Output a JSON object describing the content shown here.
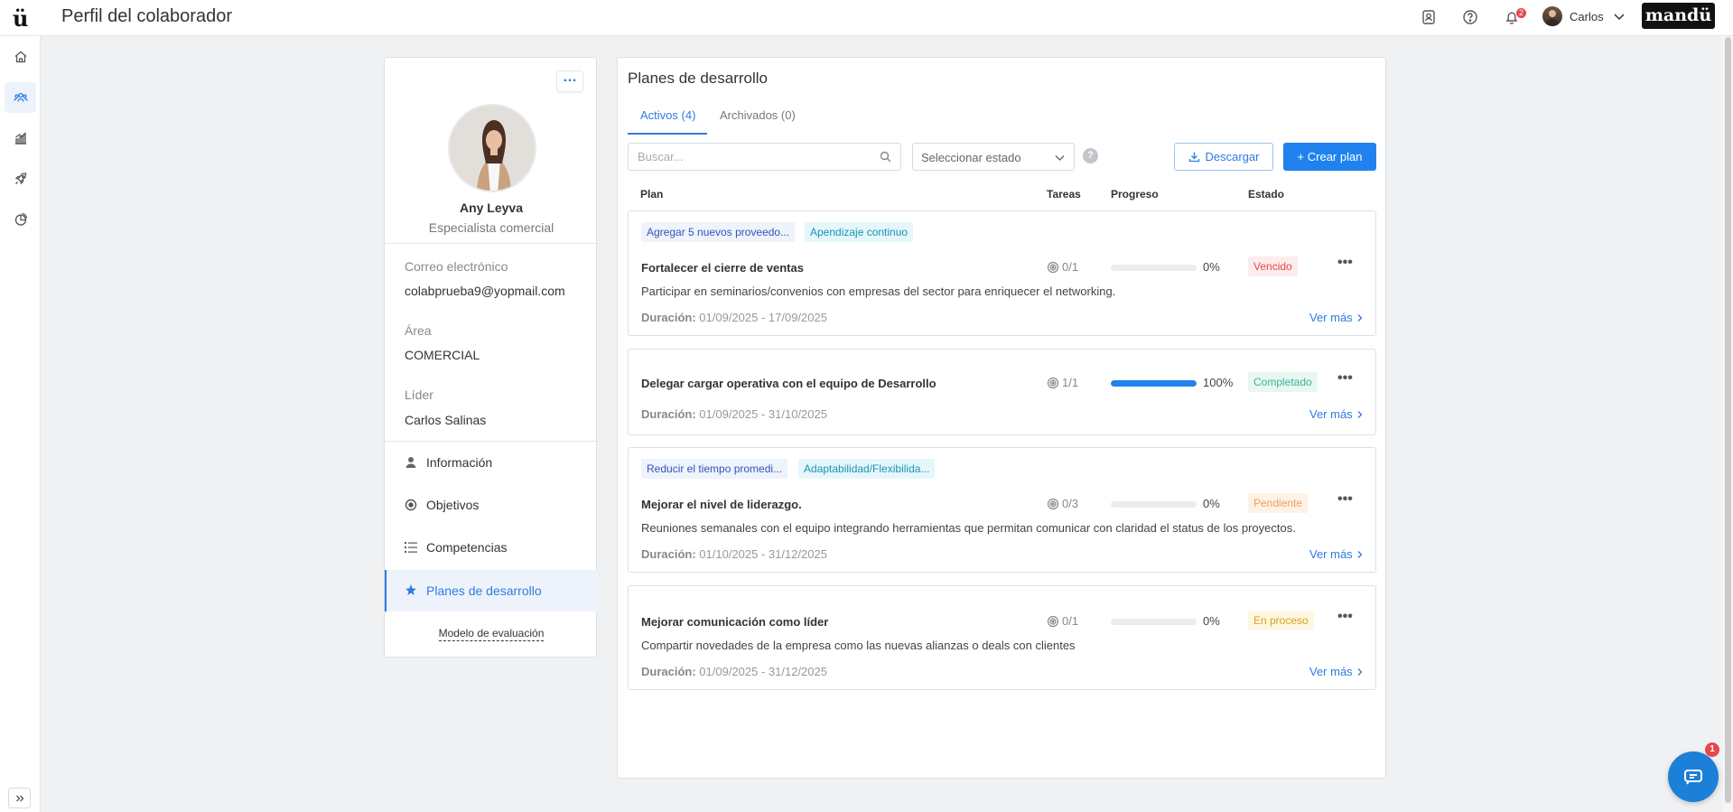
{
  "header": {
    "title": "Perfil del colaborador",
    "logo_letter": "ü",
    "brand": "mandü",
    "notifications_count": "2",
    "user_name": "Carlos"
  },
  "profile": {
    "name": "Any Leyva",
    "role": "Especialista comercial",
    "email_label": "Correo electrónico",
    "email": "colabprueba9@yopmail.com",
    "area_label": "Área",
    "area": "COMERCIAL",
    "leader_label": "Líder",
    "leader": "Carlos Salinas",
    "menu": [
      {
        "label": "Información"
      },
      {
        "label": "Objetivos"
      },
      {
        "label": "Competencias"
      },
      {
        "label": "Planes de desarrollo"
      }
    ],
    "eval_model": "Modelo de evaluación"
  },
  "plans": {
    "title": "Planes de desarrollo",
    "tab_active": "Activos (4)",
    "tab_archived": "Archivados (0)",
    "search_placeholder": "Buscar...",
    "select_placeholder": "Seleccionar estado",
    "help": "?",
    "download_label": "Descargar",
    "create_label": "+ Crear plan",
    "columns": {
      "plan": "Plan",
      "tasks": "Tareas",
      "progress": "Progreso",
      "status": "Estado"
    },
    "duration_label": "Duración:",
    "more_label": "Ver más",
    "items": [
      {
        "chips": [
          "Agregar 5 nuevos proveedo...",
          "Apendizaje continuo"
        ],
        "name": "Fortalecer el cierre de ventas",
        "description": "Participar en seminarios/convenios con empresas del sector para enriquecer el networking.",
        "duration": "01/09/2025 - 17/09/2025",
        "tasks": "0/1",
        "progress": 0,
        "progress_label": "0%",
        "status": "Vencido",
        "status_color": "#e5484d",
        "status_bg": "#fdecec"
      },
      {
        "chips": [],
        "name": "Delegar cargar operativa con el equipo de Desarrollo",
        "description": "",
        "duration": "01/09/2025 - 31/10/2025",
        "tasks": "1/1",
        "progress": 1.0,
        "progress_label": "100%",
        "status": "Completado",
        "status_color": "#3bb39a",
        "status_bg": "#e8f7f2"
      },
      {
        "chips": [
          "Reducir el tiempo promedi...",
          "Adaptabilidad/Flexibilida..."
        ],
        "name": "Mejorar el nivel de liderazgo.",
        "description": "Reuniones semanales con el equipo integrando herramientas que permitan comunicar con claridad el status de los proyectos.",
        "duration": "01/10/2025 - 31/12/2025",
        "tasks": "0/3",
        "progress": 0,
        "progress_label": "0%",
        "status": "Pendiente",
        "status_color": "#f0a25a",
        "status_bg": "#fef1e6"
      },
      {
        "chips": [],
        "name": "Mejorar comunicación como líder",
        "description": "Compartir novedades de la empresa como las nuevas alianzas o deals con clientes",
        "duration": "01/09/2025 - 31/12/2025",
        "tasks": "0/1",
        "progress": 0,
        "progress_label": "0%",
        "status": "En proceso",
        "status_color": "#d9a21b",
        "status_bg": "#fdf7e2"
      }
    ]
  },
  "chat": {
    "badge": "1"
  }
}
